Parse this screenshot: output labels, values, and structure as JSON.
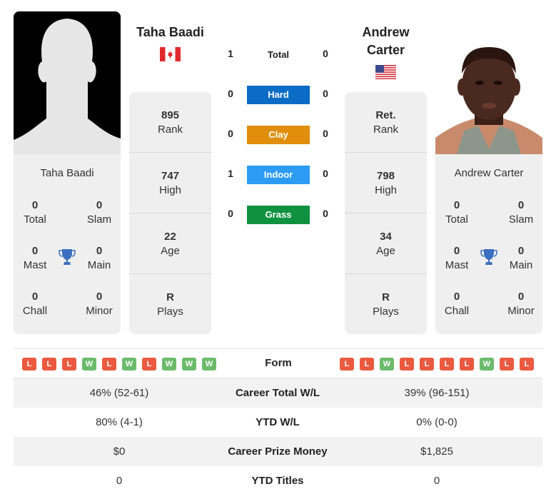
{
  "colors": {
    "hard": "#0a6cc4",
    "clay": "#e08e0b",
    "indoor": "#2b9bf4",
    "grass": "#0f9240",
    "loss": "#ea5a40",
    "win": "#6cbb6c",
    "card_bg": "#efefef",
    "trophy": "#3b6fbf"
  },
  "player_left": {
    "name": "Taha Baadi",
    "country_flag": "canada-flag",
    "photo": "silhouette-placeholder",
    "rank": {
      "value": "895",
      "label": "Rank"
    },
    "high": {
      "value": "747",
      "label": "High"
    },
    "age": {
      "value": "22",
      "label": "Age"
    },
    "plays": {
      "value": "R",
      "label": "Plays"
    },
    "titles": {
      "total": {
        "value": "0",
        "label": "Total"
      },
      "slam": {
        "value": "0",
        "label": "Slam"
      },
      "mast": {
        "value": "0",
        "label": "Mast"
      },
      "main": {
        "value": "0",
        "label": "Main"
      },
      "chall": {
        "value": "0",
        "label": "Chall"
      },
      "minor": {
        "value": "0",
        "label": "Minor"
      }
    },
    "form": [
      "L",
      "L",
      "L",
      "W",
      "L",
      "W",
      "L",
      "W",
      "W",
      "W"
    ]
  },
  "player_right": {
    "name_line1": "Andrew",
    "name_line2": "Carter",
    "name": "Andrew Carter",
    "country_flag": "usa-flag",
    "photo": "player-photo",
    "rank": {
      "value": "Ret.",
      "label": "Rank"
    },
    "high": {
      "value": "798",
      "label": "High"
    },
    "age": {
      "value": "34",
      "label": "Age"
    },
    "plays": {
      "value": "R",
      "label": "Plays"
    },
    "titles": {
      "total": {
        "value": "0",
        "label": "Total"
      },
      "slam": {
        "value": "0",
        "label": "Slam"
      },
      "mast": {
        "value": "0",
        "label": "Mast"
      },
      "main": {
        "value": "0",
        "label": "Main"
      },
      "chall": {
        "value": "0",
        "label": "Chall"
      },
      "minor": {
        "value": "0",
        "label": "Minor"
      }
    },
    "form": [
      "L",
      "L",
      "W",
      "L",
      "L",
      "L",
      "L",
      "W",
      "L",
      "L"
    ]
  },
  "h2h": {
    "total": {
      "label": "Total",
      "left": "1",
      "right": "0"
    },
    "surfaces": [
      {
        "key": "hard",
        "label": "Hard",
        "left": "0",
        "right": "0"
      },
      {
        "key": "clay",
        "label": "Clay",
        "left": "0",
        "right": "0"
      },
      {
        "key": "indoor",
        "label": "Indoor",
        "left": "1",
        "right": "0"
      },
      {
        "key": "grass",
        "label": "Grass",
        "left": "0",
        "right": "0"
      }
    ]
  },
  "form_label": "Form",
  "stats": [
    {
      "label": "Career Total W/L",
      "left": "46% (52-61)",
      "right": "39% (96-151)"
    },
    {
      "label": "YTD W/L",
      "left": "80% (4-1)",
      "right": "0% (0-0)"
    },
    {
      "label": "Career Prize Money",
      "left": "$0",
      "right": "$1,825"
    },
    {
      "label": "YTD Titles",
      "left": "0",
      "right": "0"
    }
  ]
}
